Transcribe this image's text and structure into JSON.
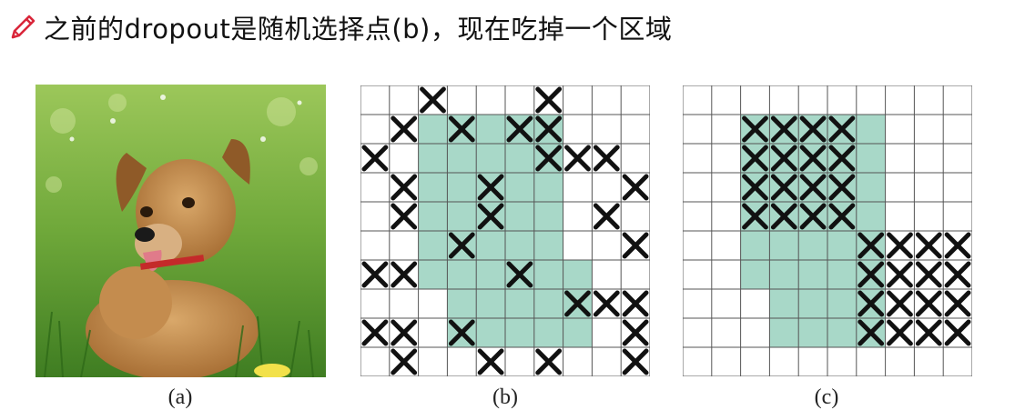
{
  "heading": {
    "icon": "pencil-icon",
    "text": "之前的dropout是随机选择点(b)，现在吃掉一个区域",
    "accent_color": "#d9263a"
  },
  "figure": {
    "photo": {
      "caption": "(a)",
      "subject": "dog-in-grass"
    },
    "grid_b": {
      "caption": "(b)",
      "rows": 10,
      "cols": 10,
      "region_color": "#a8d8c8",
      "region_cells": [
        [
          1,
          2
        ],
        [
          1,
          3
        ],
        [
          1,
          4
        ],
        [
          1,
          5
        ],
        [
          1,
          6
        ],
        [
          2,
          2
        ],
        [
          2,
          3
        ],
        [
          2,
          4
        ],
        [
          2,
          5
        ],
        [
          2,
          6
        ],
        [
          3,
          2
        ],
        [
          3,
          3
        ],
        [
          3,
          4
        ],
        [
          3,
          5
        ],
        [
          3,
          6
        ],
        [
          4,
          2
        ],
        [
          4,
          3
        ],
        [
          4,
          4
        ],
        [
          4,
          5
        ],
        [
          4,
          6
        ],
        [
          5,
          2
        ],
        [
          5,
          3
        ],
        [
          5,
          4
        ],
        [
          5,
          5
        ],
        [
          5,
          6
        ],
        [
          6,
          2
        ],
        [
          6,
          3
        ],
        [
          6,
          4
        ],
        [
          6,
          5
        ],
        [
          6,
          6
        ],
        [
          6,
          7
        ],
        [
          7,
          3
        ],
        [
          7,
          4
        ],
        [
          7,
          5
        ],
        [
          7,
          6
        ],
        [
          7,
          7
        ],
        [
          8,
          3
        ],
        [
          8,
          4
        ],
        [
          8,
          5
        ],
        [
          8,
          6
        ],
        [
          8,
          7
        ]
      ],
      "dropped_cells": [
        [
          0,
          2
        ],
        [
          0,
          6
        ],
        [
          1,
          1
        ],
        [
          1,
          3
        ],
        [
          1,
          5
        ],
        [
          1,
          6
        ],
        [
          2,
          0
        ],
        [
          2,
          6
        ],
        [
          2,
          7
        ],
        [
          2,
          8
        ],
        [
          3,
          1
        ],
        [
          3,
          4
        ],
        [
          3,
          9
        ],
        [
          4,
          1
        ],
        [
          4,
          4
        ],
        [
          4,
          8
        ],
        [
          5,
          3
        ],
        [
          5,
          9
        ],
        [
          6,
          0
        ],
        [
          6,
          1
        ],
        [
          6,
          5
        ],
        [
          7,
          7
        ],
        [
          7,
          8
        ],
        [
          7,
          9
        ],
        [
          8,
          0
        ],
        [
          8,
          1
        ],
        [
          8,
          3
        ],
        [
          8,
          9
        ],
        [
          9,
          1
        ],
        [
          9,
          4
        ],
        [
          9,
          6
        ],
        [
          9,
          9
        ]
      ]
    },
    "grid_c": {
      "caption": "(c)",
      "rows": 10,
      "cols": 10,
      "region_color": "#a8d8c8",
      "region_cells": [
        [
          1,
          2
        ],
        [
          1,
          3
        ],
        [
          1,
          4
        ],
        [
          1,
          5
        ],
        [
          1,
          6
        ],
        [
          2,
          2
        ],
        [
          2,
          3
        ],
        [
          2,
          4
        ],
        [
          2,
          5
        ],
        [
          2,
          6
        ],
        [
          3,
          2
        ],
        [
          3,
          3
        ],
        [
          3,
          4
        ],
        [
          3,
          5
        ],
        [
          3,
          6
        ],
        [
          4,
          2
        ],
        [
          4,
          3
        ],
        [
          4,
          4
        ],
        [
          4,
          5
        ],
        [
          4,
          6
        ],
        [
          5,
          2
        ],
        [
          5,
          3
        ],
        [
          5,
          4
        ],
        [
          5,
          5
        ],
        [
          5,
          6
        ],
        [
          6,
          2
        ],
        [
          6,
          3
        ],
        [
          6,
          4
        ],
        [
          6,
          5
        ],
        [
          6,
          6
        ],
        [
          7,
          3
        ],
        [
          7,
          4
        ],
        [
          7,
          5
        ],
        [
          7,
          6
        ],
        [
          8,
          3
        ],
        [
          8,
          4
        ],
        [
          8,
          5
        ],
        [
          8,
          6
        ]
      ],
      "dropped_cells": [
        [
          1,
          2
        ],
        [
          1,
          3
        ],
        [
          1,
          4
        ],
        [
          1,
          5
        ],
        [
          2,
          2
        ],
        [
          2,
          3
        ],
        [
          2,
          4
        ],
        [
          2,
          5
        ],
        [
          3,
          2
        ],
        [
          3,
          3
        ],
        [
          3,
          4
        ],
        [
          3,
          5
        ],
        [
          4,
          2
        ],
        [
          4,
          3
        ],
        [
          4,
          4
        ],
        [
          4,
          5
        ],
        [
          5,
          6
        ],
        [
          5,
          7
        ],
        [
          5,
          8
        ],
        [
          5,
          9
        ],
        [
          6,
          6
        ],
        [
          6,
          7
        ],
        [
          6,
          8
        ],
        [
          6,
          9
        ],
        [
          7,
          6
        ],
        [
          7,
          7
        ],
        [
          7,
          8
        ],
        [
          7,
          9
        ],
        [
          8,
          6
        ],
        [
          8,
          7
        ],
        [
          8,
          8
        ],
        [
          8,
          9
        ]
      ]
    }
  }
}
